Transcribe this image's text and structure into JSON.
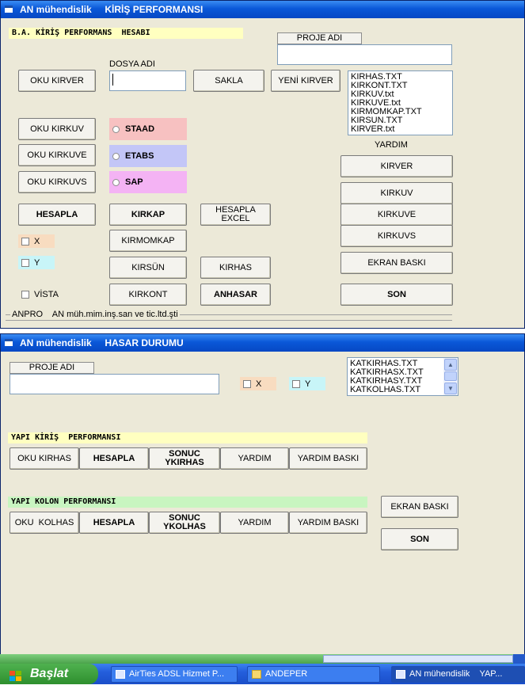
{
  "win1": {
    "title": "AN mühendislik     KİRİŞ PERFORMANSI",
    "header_bar": "B.A. KİRİŞ PERFORMANS  HESABI",
    "proje_tab": "PROJE ADI",
    "dosya_label": "DOSYA ADI",
    "buttons": {
      "oku_kirver": "OKU KIRVER",
      "sakla": "SAKLA",
      "yeni_kirver": "YENİ KIRVER",
      "oku_kirkuv": "OKU KIRKUV",
      "oku_kirkuve": "OKU KIRKUVE",
      "oku_kirkuvs": "OKU KIRKUVS",
      "hesapla": "HESAPLA",
      "kirkap": "KIRKAP",
      "hesapla_excel_1": "HESAPLA",
      "hesapla_excel_2": "EXCEL",
      "kirmomkap": "KIRMOMKAP",
      "kirsun": "KIRSÜN",
      "kirhas": "KIRHAS",
      "kirkont": "KIRKONT",
      "anhasar": "ANHASAR",
      "kirver": "KIRVER",
      "kirkuv": "KIRKUV",
      "kirkuve": "KIRKUVE",
      "kirkuvs": "KIRKUVS",
      "ekran_baski": "EKRAN BASKI",
      "son": "SON"
    },
    "radios": {
      "staad": "STAAD",
      "etabs": "ETABS",
      "sap": "SAP"
    },
    "checks": {
      "x": "X",
      "y": "Y",
      "vista": "VİSTA"
    },
    "files": [
      "KIRHAS.TXT",
      "KIRKONT.TXT",
      "KIRKUV.txt",
      "KIRKUVE.txt",
      "KIRMOMKAP.TXT",
      "KIRSUN.TXT",
      "KIRVER.txt"
    ],
    "yardim_label": "YARDIM",
    "group_label": "ANPRO    AN müh.mim.inş.san ve tic.ltd.şti"
  },
  "win2": {
    "title": "AN mühendislik     HASAR DURUMU",
    "proje_tab": "PROJE ADI",
    "checks": {
      "x": "X",
      "y": "Y"
    },
    "files": [
      "KATKIRHAS.TXT",
      "KATKIRHASX.TXT",
      "KATKIRHASY.TXT",
      "KATKOLHAS.TXT"
    ],
    "kiris_bar": "YAPI KİRİŞ  PERFORMANSI",
    "kolon_bar": "YAPI KOLON PERFORMANSI",
    "kiris_buttons": {
      "oku": "OKU KIRHAS",
      "hesapla": "HESAPLA",
      "sonuc_1": "SONUC",
      "sonuc_2": "YKIRHAS",
      "yardim": "YARDIM",
      "yardim_baski": "YARDIM BASKI"
    },
    "kolon_buttons": {
      "oku": "OKU  KOLHAS",
      "hesapla": "HESAPLA",
      "sonuc_1": "SONUC",
      "sonuc_2": "YKOLHAS",
      "yardim": "YARDIM",
      "yardim_baski": "YARDIM BASKI"
    },
    "ekran_baski": "EKRAN BASKI",
    "son": "SON"
  },
  "taskbar": {
    "start": "Başlat",
    "tasks": [
      "AirTies ADSL Hizmet P...",
      "ANDEPER",
      "AN mühendislik    YAP..."
    ]
  },
  "colors": {
    "title_blue": "#0a58d8",
    "bar_yellow": "#ffffc0",
    "bar_green": "#c8f5c0",
    "staad_bg": "#f7c1c1",
    "etabs_bg": "#c3c6f7",
    "sap_bg": "#f4b3f4",
    "x_bg": "#f8dcc0",
    "y_bg": "#c8f5f8"
  }
}
